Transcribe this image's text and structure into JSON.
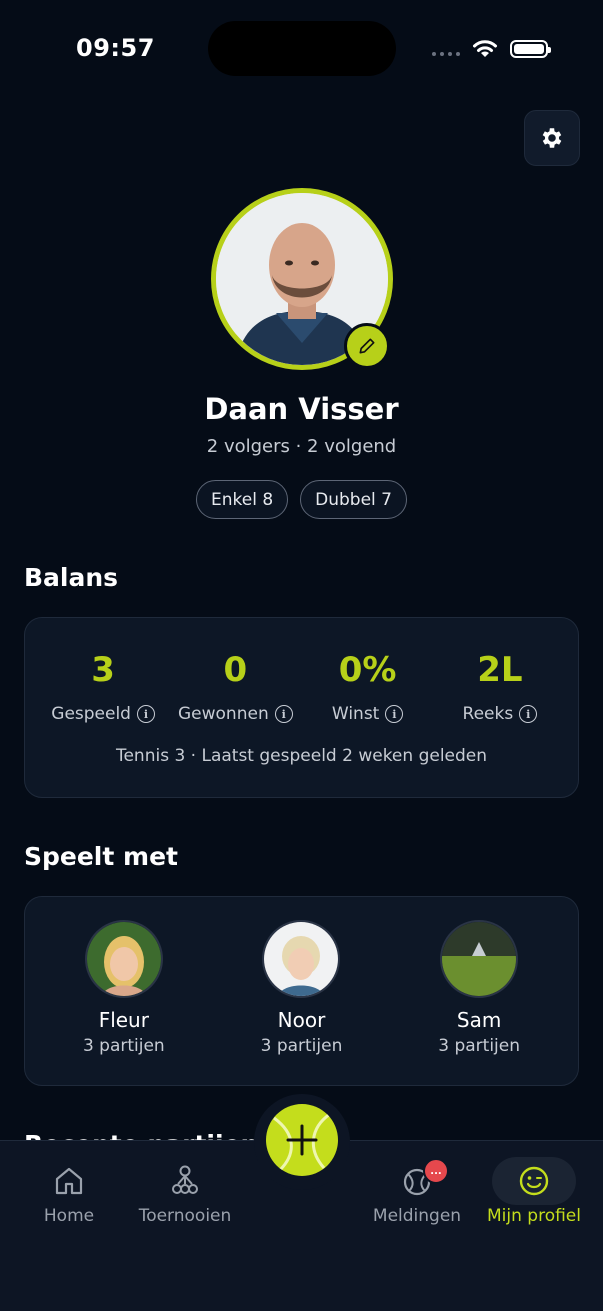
{
  "status_bar": {
    "time": "09:57"
  },
  "profile": {
    "name": "Daan Visser",
    "followers": "2 volgers · 2 volgend",
    "chips": [
      "Enkel 8",
      "Dubbel 7"
    ]
  },
  "balance": {
    "title": "Balans",
    "stats": [
      {
        "value": "3",
        "label": "Gespeeld"
      },
      {
        "value": "0",
        "label": "Gewonnen"
      },
      {
        "value": "0%",
        "label": "Winst"
      },
      {
        "value": "2L",
        "label": "Reeks"
      }
    ],
    "footer": "Tennis 3 · Laatst gespeeld 2 weken geleden"
  },
  "plays_with": {
    "title": "Speelt met",
    "players": [
      {
        "name": "Fleur",
        "matches": "3 partijen"
      },
      {
        "name": "Noor",
        "matches": "3 partijen"
      },
      {
        "name": "Sam",
        "matches": "3 partijen"
      }
    ]
  },
  "next_section_title": "Recente partijen",
  "tabbar": {
    "tabs": [
      {
        "label": "Home",
        "icon": "home-icon"
      },
      {
        "label": "Toernooien",
        "icon": "tournament-icon"
      },
      {
        "label": "Meldingen",
        "icon": "notifications-icon"
      },
      {
        "label": "Mijn profiel",
        "icon": "smile-icon"
      }
    ],
    "badge": "..."
  },
  "colors": {
    "accent": "#c4dd1c",
    "background": "#050c17",
    "card": "#0d1726"
  }
}
